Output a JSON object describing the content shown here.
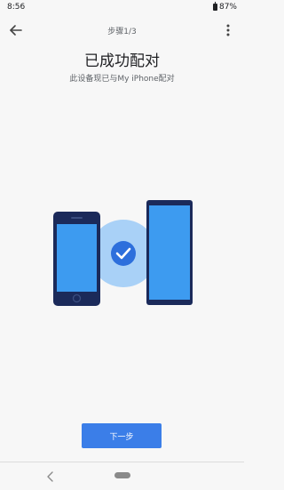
{
  "status_bar": {
    "time": "8:56",
    "battery": "87%"
  },
  "header": {
    "step": "步骤1/3",
    "back_icon": "arrow-back-icon",
    "more_icon": "more-vert-icon"
  },
  "content": {
    "title": "已成功配对",
    "subtitle": "此设备现已与My iPhone配对"
  },
  "illustration": {
    "check_icon": "check-icon"
  },
  "footer": {
    "next_label": "下一步"
  },
  "colors": {
    "primary": "#3b7ee8",
    "phone_body": "#1b2a5a",
    "phone_screen": "#3d9bf0",
    "halo": "#a9d1f7",
    "check_circle": "#2d6fdc"
  }
}
